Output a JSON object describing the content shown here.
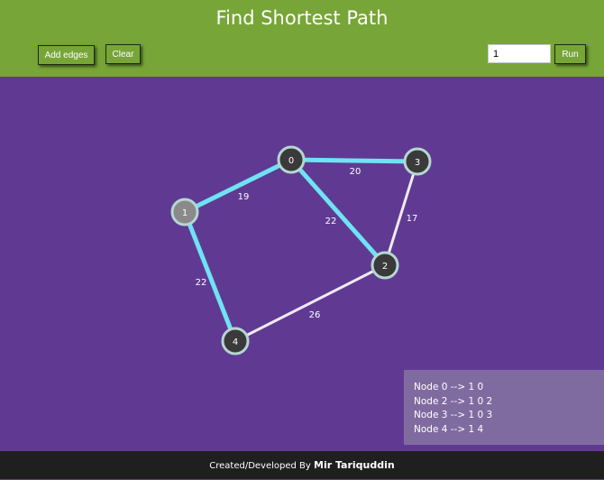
{
  "header": {
    "title": "Find Shortest Path",
    "add_edges_label": "Add edges",
    "clear_label": "Clear",
    "source_value": "1",
    "run_label": "Run"
  },
  "graph": {
    "nodes": [
      {
        "id": "0",
        "state": "default"
      },
      {
        "id": "1",
        "state": "source"
      },
      {
        "id": "2",
        "state": "default"
      },
      {
        "id": "3",
        "state": "default"
      },
      {
        "id": "4",
        "state": "default"
      }
    ],
    "edges": [
      {
        "from": "1",
        "to": "0",
        "weight": "19",
        "on_path": true
      },
      {
        "from": "0",
        "to": "3",
        "weight": "20",
        "on_path": true
      },
      {
        "from": "0",
        "to": "2",
        "weight": "22",
        "on_path": true
      },
      {
        "from": "3",
        "to": "2",
        "weight": "17",
        "on_path": false
      },
      {
        "from": "1",
        "to": "4",
        "weight": "22",
        "on_path": true
      },
      {
        "from": "4",
        "to": "2",
        "weight": "26",
        "on_path": false
      }
    ],
    "colors": {
      "path_edge": "#6fe3f3",
      "normal_edge": "#efeaf5",
      "node_fill": "#3a3a3a",
      "source_fill": "#8a8a8a",
      "node_border": "#b5d6d1"
    }
  },
  "results": [
    "Node 0 --> 1 0",
    "Node 2 --> 1 0 2",
    "Node 3 --> 1 0 3",
    "Node 4 --> 1 4"
  ],
  "footer": {
    "prefix": "Created/Developed By ",
    "author": "Mir Tariquddin"
  }
}
